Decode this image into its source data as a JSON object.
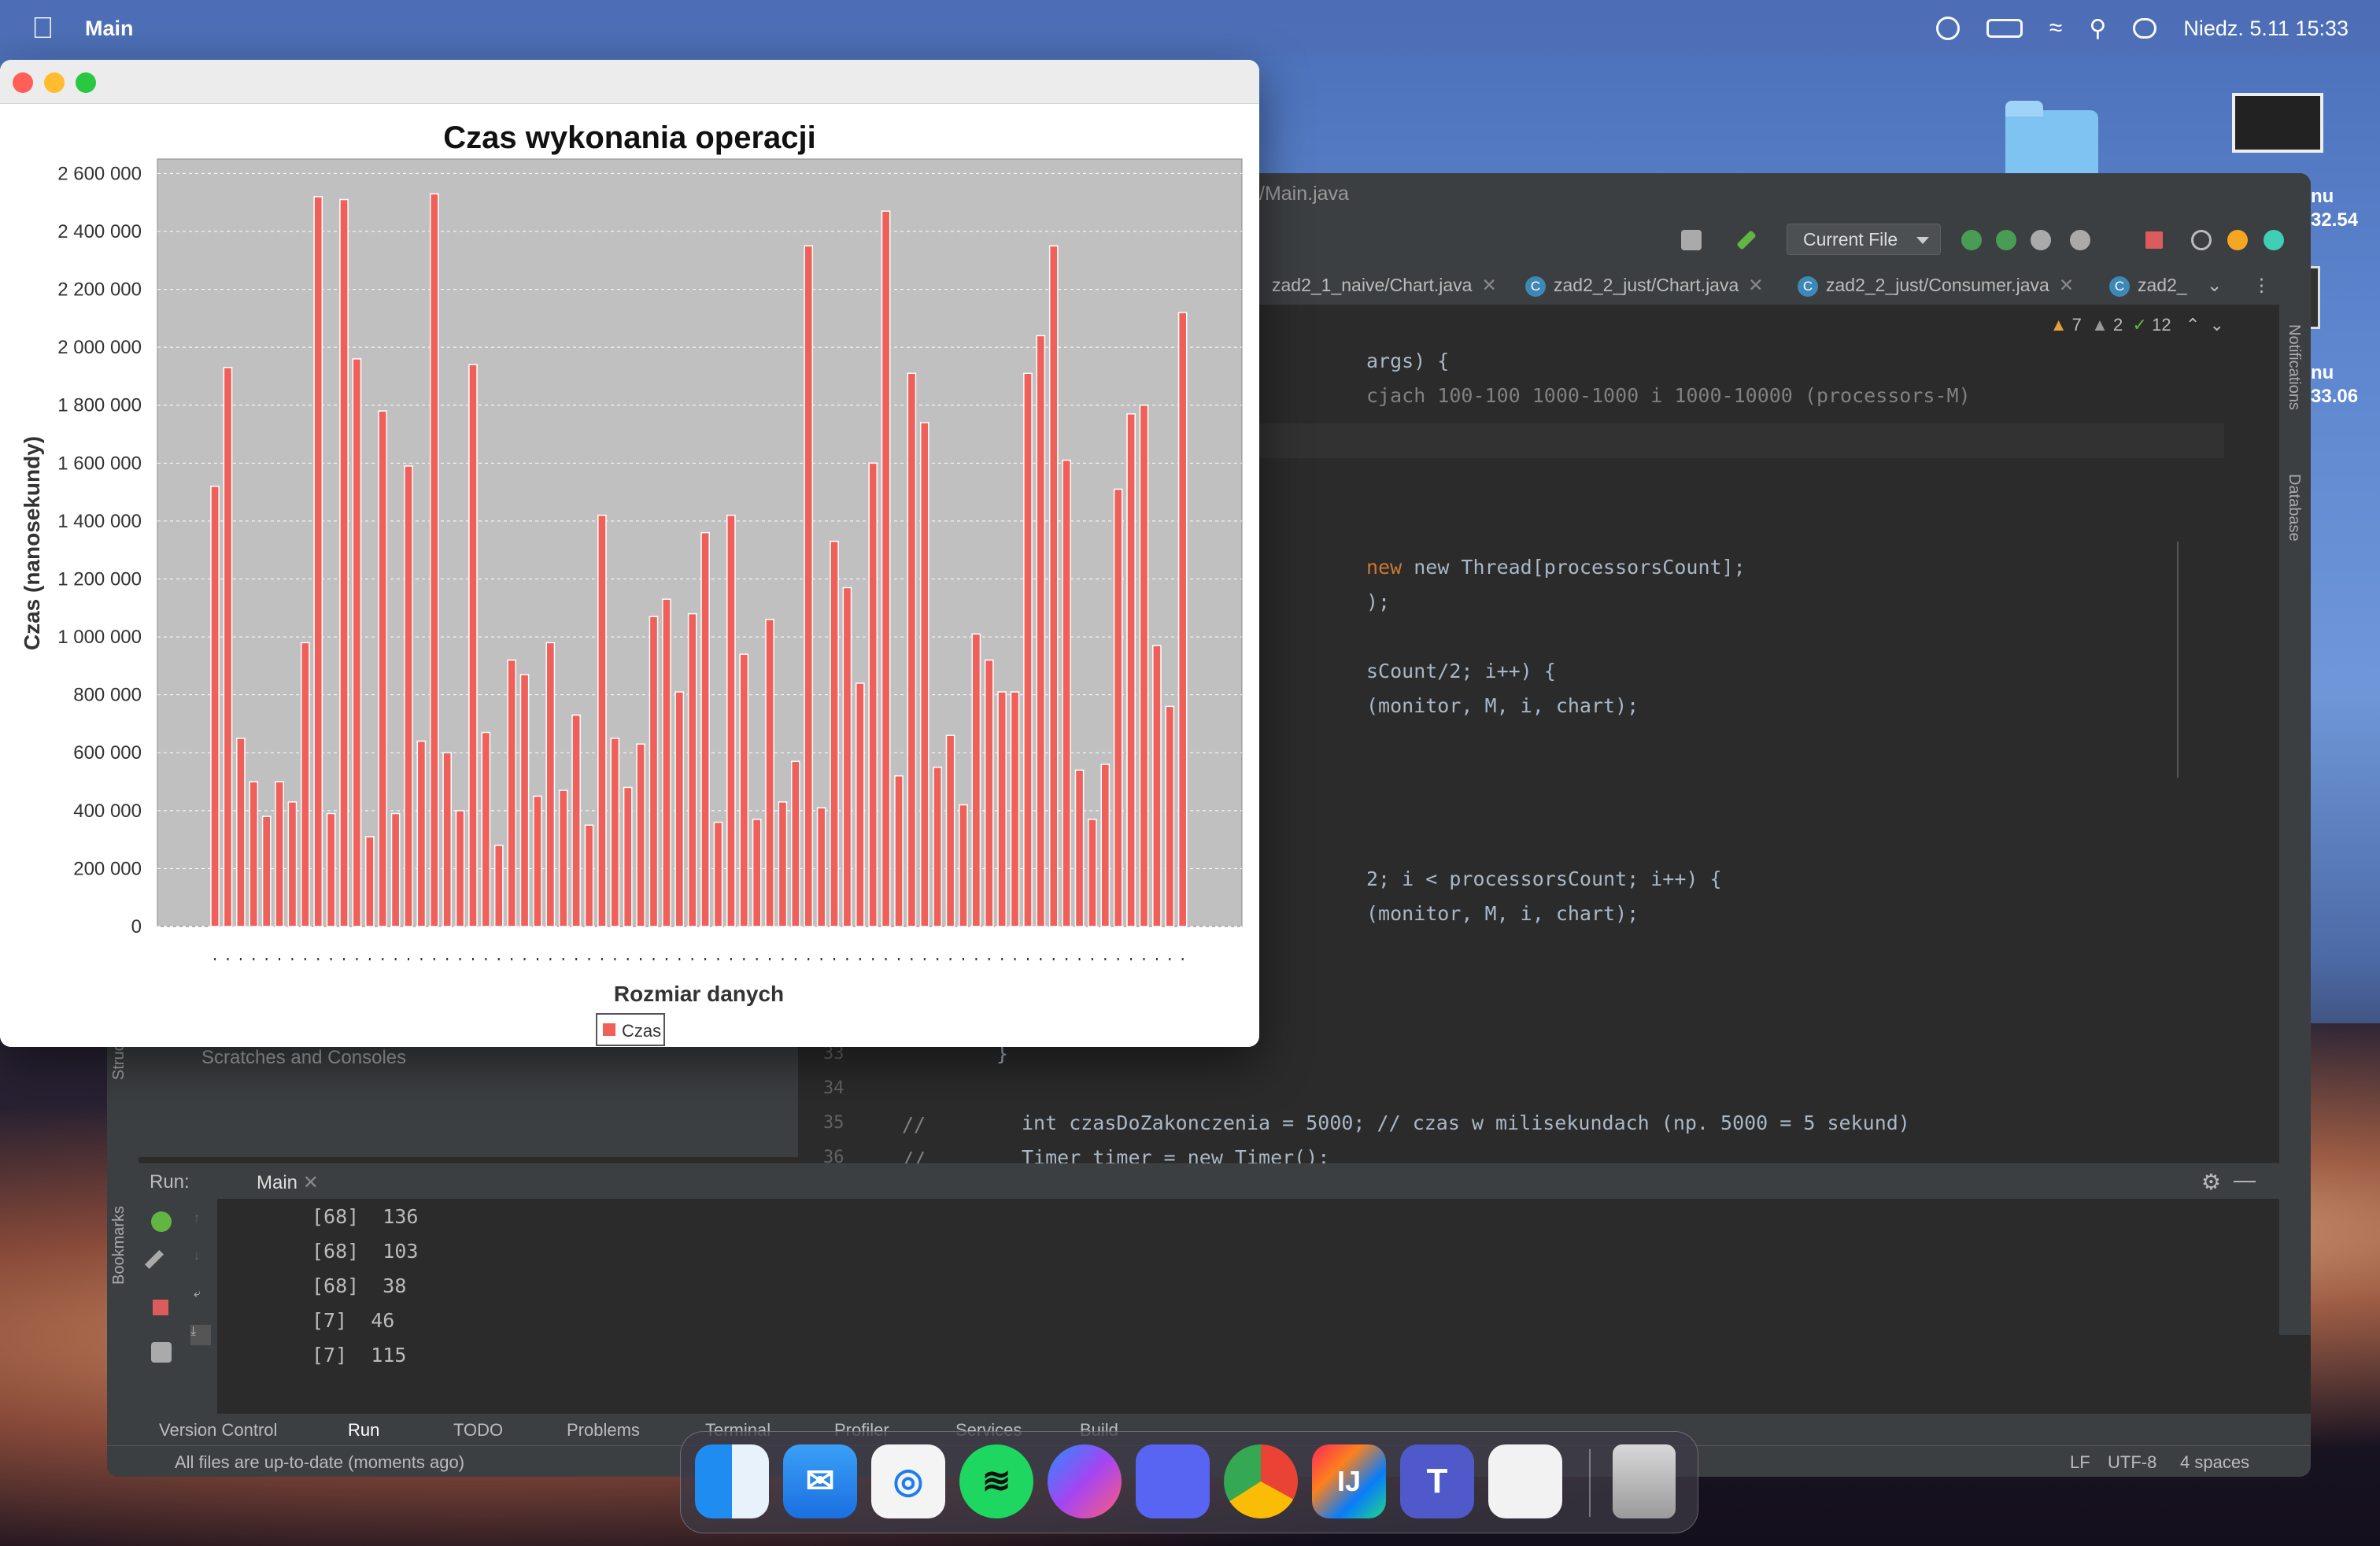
{
  "menubar": {
    "app_name": "Main",
    "datetime": "Niedz. 5.11  15:33",
    "icons": [
      "apple-icon",
      "play-circle-icon",
      "battery-icon",
      "wifi-icon",
      "search-icon",
      "control-center-icon"
    ]
  },
  "desktop": {
    "label_top": "nu",
    "label_time1": "32.54",
    "label_bottom": "nu",
    "label_time2": "33.06"
  },
  "ide": {
    "window_title": "/Main.java",
    "run_config": "Current File",
    "tabs": [
      {
        "label": "zad2_1_naive/Chart.java"
      },
      {
        "label": "zad2_2_just/Chart.java"
      },
      {
        "label": "zad2_2_just/Consumer.java"
      },
      {
        "label": "zad2_"
      }
    ],
    "inspections": {
      "warnings": "7",
      "weak_warnings": "2",
      "ok": "12"
    },
    "code_lines": [
      "args) {",
      "cjach 100-100 1000-1000 i 1000-10000 (processors-M)",
      "new Thread[processorsCount];",
      ");",
      "sCount/2; i++) {",
      "(monitor, M, i, chart);",
      "2; i < processorsCount; i++) {",
      "(monitor, M, i, chart);",
      "}",
      "int czasDoZakonczenia = 5000; // czas w milisekundach (np. 5000 = 5 sekund)",
      "Timer timer = new Timer();"
    ],
    "line_numbers": [
      "33",
      "34",
      "35",
      "36"
    ],
    "gutter_comments": [
      "//",
      "//"
    ],
    "right_panels": [
      "Notifications",
      "Database"
    ],
    "left_panels": [
      "Structure",
      "Bookmarks"
    ],
    "project_item": "Scratches and Consoles",
    "run": {
      "label": "Run:",
      "tab": "Main",
      "output": [
        "[68]  136",
        "[68]  103",
        "[68]  38",
        "[7]  46",
        "[7]  115"
      ]
    },
    "bottom_tabs": [
      "Version Control",
      "Run",
      "TODO",
      "Problems",
      "Terminal",
      "Profiler",
      "Services",
      "Build"
    ],
    "status": {
      "message": "All files are up-to-date (moments ago)",
      "line_sep": "LF",
      "encoding": "UTF-8",
      "indent": "4 spaces"
    }
  },
  "dock": {
    "apps": [
      "Finder",
      "Mail",
      "Safari",
      "Spotify",
      "Messenger",
      "Discord",
      "Chrome",
      "IntelliJ IDEA",
      "Teams",
      "Java",
      "Trash"
    ]
  },
  "chart_window": {
    "buttons": [
      "close",
      "minimize",
      "zoom"
    ]
  },
  "chart_data": {
    "type": "bar",
    "title": "Czas wykonania operacji",
    "xlabel": "Rozmiar danych",
    "ylabel": "Czas (nanosekundy)",
    "ylim": [
      0,
      2650000
    ],
    "yticks": [
      0,
      200000,
      400000,
      600000,
      800000,
      1000000,
      1200000,
      1400000,
      1600000,
      1800000,
      2000000,
      2200000,
      2400000,
      2600000
    ],
    "ytick_labels": [
      "0",
      "200 000",
      "400 000",
      "600 000",
      "800 000",
      "1 000 000",
      "1 200 000",
      "1 400 000",
      "1 600 000",
      "1 800 000",
      "2 000 000",
      "2 200 000",
      "2 400 000",
      "2 600 000"
    ],
    "grid": true,
    "legend_position": "bottom",
    "series": [
      {
        "name": "Czas",
        "color": "#f0605a",
        "values": [
          1520000,
          1930000,
          650000,
          500000,
          380000,
          500000,
          430000,
          980000,
          2520000,
          390000,
          2510000,
          1960000,
          310000,
          1780000,
          390000,
          1590000,
          640000,
          2530000,
          600000,
          400000,
          1940000,
          670000,
          280000,
          920000,
          870000,
          450000,
          980000,
          470000,
          730000,
          350000,
          1420000,
          650000,
          480000,
          630000,
          1070000,
          1130000,
          810000,
          1080000,
          1360000,
          360000,
          1420000,
          940000,
          370000,
          1060000,
          430000,
          570000,
          2350000,
          410000,
          1330000,
          1170000,
          840000,
          1600000,
          2470000,
          520000,
          1910000,
          1740000,
          550000,
          660000,
          420000,
          1010000,
          920000,
          810000,
          810000,
          1910000,
          2040000,
          2350000,
          1610000,
          540000,
          370000,
          560000,
          1510000,
          1770000,
          1800000,
          970000,
          760000,
          2120000
        ]
      }
    ]
  }
}
